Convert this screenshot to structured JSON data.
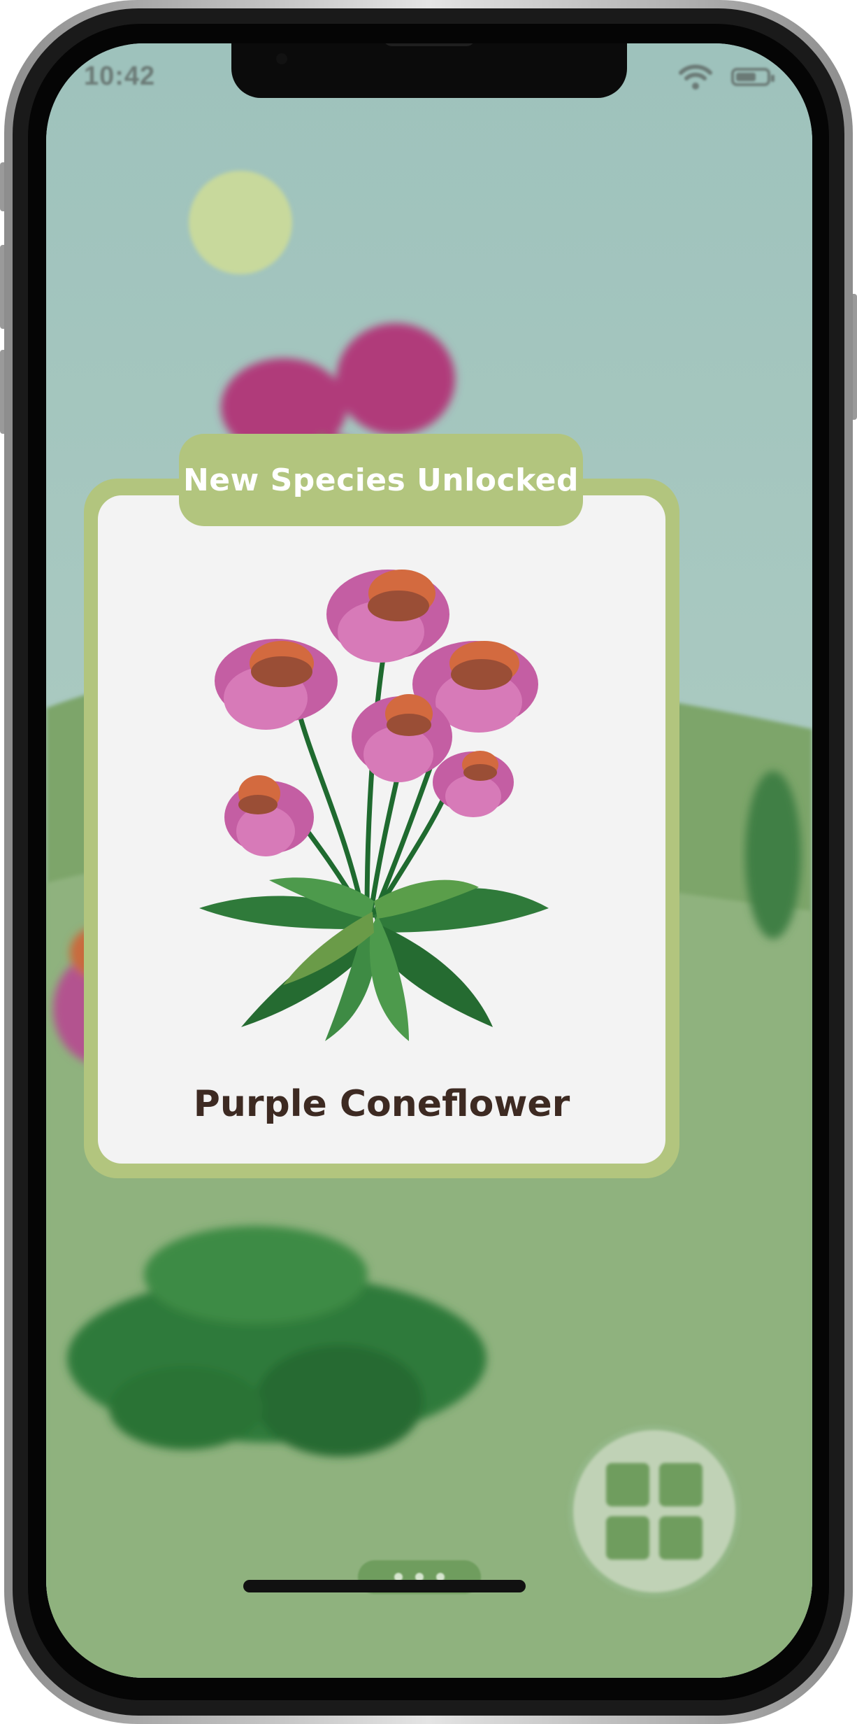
{
  "status_bar": {
    "time": "10:42",
    "wifi_icon": "wifi-icon",
    "battery_icon": "battery-icon"
  },
  "unlock_card": {
    "badge_label": "New Species Unlocked",
    "species_name": "Purple Coneflower",
    "illustration_icon": "purple-coneflower-illustration"
  },
  "controls": {
    "grid_button_icon": "grid-icon",
    "page_dots": 3
  },
  "colors": {
    "sky": "#a3c7c1",
    "hills": "#7da56b",
    "card_border": "#b2c57e",
    "card_background": "#f3f3f3",
    "title_text": "#3d2a22",
    "petal": "#c45ea3",
    "cone": "#d36a3f",
    "leaf": "#2f7a3a"
  }
}
